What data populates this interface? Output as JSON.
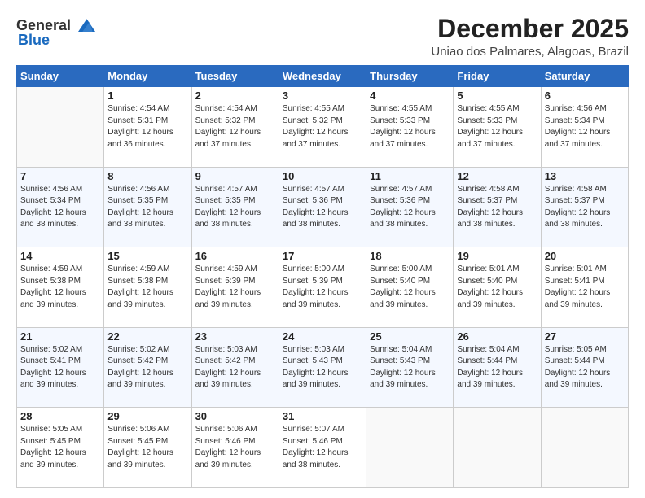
{
  "logo": {
    "general": "General",
    "blue": "Blue"
  },
  "header": {
    "month": "December 2025",
    "location": "Uniao dos Palmares, Alagoas, Brazil"
  },
  "days": [
    "Sunday",
    "Monday",
    "Tuesday",
    "Wednesday",
    "Thursday",
    "Friday",
    "Saturday"
  ],
  "weeks": [
    [
      {
        "day": "",
        "info": ""
      },
      {
        "day": "1",
        "info": "Sunrise: 4:54 AM\nSunset: 5:31 PM\nDaylight: 12 hours\nand 36 minutes."
      },
      {
        "day": "2",
        "info": "Sunrise: 4:54 AM\nSunset: 5:32 PM\nDaylight: 12 hours\nand 37 minutes."
      },
      {
        "day": "3",
        "info": "Sunrise: 4:55 AM\nSunset: 5:32 PM\nDaylight: 12 hours\nand 37 minutes."
      },
      {
        "day": "4",
        "info": "Sunrise: 4:55 AM\nSunset: 5:33 PM\nDaylight: 12 hours\nand 37 minutes."
      },
      {
        "day": "5",
        "info": "Sunrise: 4:55 AM\nSunset: 5:33 PM\nDaylight: 12 hours\nand 37 minutes."
      },
      {
        "day": "6",
        "info": "Sunrise: 4:56 AM\nSunset: 5:34 PM\nDaylight: 12 hours\nand 37 minutes."
      }
    ],
    [
      {
        "day": "7",
        "info": "Sunrise: 4:56 AM\nSunset: 5:34 PM\nDaylight: 12 hours\nand 38 minutes."
      },
      {
        "day": "8",
        "info": "Sunrise: 4:56 AM\nSunset: 5:35 PM\nDaylight: 12 hours\nand 38 minutes."
      },
      {
        "day": "9",
        "info": "Sunrise: 4:57 AM\nSunset: 5:35 PM\nDaylight: 12 hours\nand 38 minutes."
      },
      {
        "day": "10",
        "info": "Sunrise: 4:57 AM\nSunset: 5:36 PM\nDaylight: 12 hours\nand 38 minutes."
      },
      {
        "day": "11",
        "info": "Sunrise: 4:57 AM\nSunset: 5:36 PM\nDaylight: 12 hours\nand 38 minutes."
      },
      {
        "day": "12",
        "info": "Sunrise: 4:58 AM\nSunset: 5:37 PM\nDaylight: 12 hours\nand 38 minutes."
      },
      {
        "day": "13",
        "info": "Sunrise: 4:58 AM\nSunset: 5:37 PM\nDaylight: 12 hours\nand 38 minutes."
      }
    ],
    [
      {
        "day": "14",
        "info": "Sunrise: 4:59 AM\nSunset: 5:38 PM\nDaylight: 12 hours\nand 39 minutes."
      },
      {
        "day": "15",
        "info": "Sunrise: 4:59 AM\nSunset: 5:38 PM\nDaylight: 12 hours\nand 39 minutes."
      },
      {
        "day": "16",
        "info": "Sunrise: 4:59 AM\nSunset: 5:39 PM\nDaylight: 12 hours\nand 39 minutes."
      },
      {
        "day": "17",
        "info": "Sunrise: 5:00 AM\nSunset: 5:39 PM\nDaylight: 12 hours\nand 39 minutes."
      },
      {
        "day": "18",
        "info": "Sunrise: 5:00 AM\nSunset: 5:40 PM\nDaylight: 12 hours\nand 39 minutes."
      },
      {
        "day": "19",
        "info": "Sunrise: 5:01 AM\nSunset: 5:40 PM\nDaylight: 12 hours\nand 39 minutes."
      },
      {
        "day": "20",
        "info": "Sunrise: 5:01 AM\nSunset: 5:41 PM\nDaylight: 12 hours\nand 39 minutes."
      }
    ],
    [
      {
        "day": "21",
        "info": "Sunrise: 5:02 AM\nSunset: 5:41 PM\nDaylight: 12 hours\nand 39 minutes."
      },
      {
        "day": "22",
        "info": "Sunrise: 5:02 AM\nSunset: 5:42 PM\nDaylight: 12 hours\nand 39 minutes."
      },
      {
        "day": "23",
        "info": "Sunrise: 5:03 AM\nSunset: 5:42 PM\nDaylight: 12 hours\nand 39 minutes."
      },
      {
        "day": "24",
        "info": "Sunrise: 5:03 AM\nSunset: 5:43 PM\nDaylight: 12 hours\nand 39 minutes."
      },
      {
        "day": "25",
        "info": "Sunrise: 5:04 AM\nSunset: 5:43 PM\nDaylight: 12 hours\nand 39 minutes."
      },
      {
        "day": "26",
        "info": "Sunrise: 5:04 AM\nSunset: 5:44 PM\nDaylight: 12 hours\nand 39 minutes."
      },
      {
        "day": "27",
        "info": "Sunrise: 5:05 AM\nSunset: 5:44 PM\nDaylight: 12 hours\nand 39 minutes."
      }
    ],
    [
      {
        "day": "28",
        "info": "Sunrise: 5:05 AM\nSunset: 5:45 PM\nDaylight: 12 hours\nand 39 minutes."
      },
      {
        "day": "29",
        "info": "Sunrise: 5:06 AM\nSunset: 5:45 PM\nDaylight: 12 hours\nand 39 minutes."
      },
      {
        "day": "30",
        "info": "Sunrise: 5:06 AM\nSunset: 5:46 PM\nDaylight: 12 hours\nand 39 minutes."
      },
      {
        "day": "31",
        "info": "Sunrise: 5:07 AM\nSunset: 5:46 PM\nDaylight: 12 hours\nand 38 minutes."
      },
      {
        "day": "",
        "info": ""
      },
      {
        "day": "",
        "info": ""
      },
      {
        "day": "",
        "info": ""
      }
    ]
  ]
}
